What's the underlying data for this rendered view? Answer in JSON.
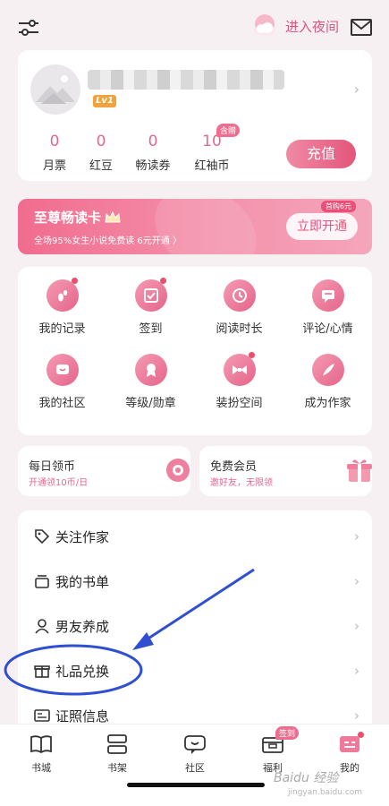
{
  "topbar": {
    "night_mode_label": "进入夜间"
  },
  "profile": {
    "level": "Lv1",
    "stats": [
      {
        "value": "0",
        "label": "月票"
      },
      {
        "value": "0",
        "label": "红豆"
      },
      {
        "value": "0",
        "label": "畅读券"
      },
      {
        "value": "10",
        "label": "红袖币",
        "tag": "含赠"
      }
    ],
    "recharge_label": "充值"
  },
  "vip_banner": {
    "title": "至尊畅读卡",
    "subtitle": "全场95%女生小说免费读 6元开通 〉",
    "button_label": "立即开通",
    "button_tag": "首购6元"
  },
  "grid": [
    {
      "label": "我的记录",
      "icon": "footprint-icon",
      "dot": true
    },
    {
      "label": "签到",
      "icon": "checkin-icon",
      "dot": true
    },
    {
      "label": "阅读时长",
      "icon": "clock-icon",
      "dot": false
    },
    {
      "label": "评论/心情",
      "icon": "comment-icon",
      "dot": false
    },
    {
      "label": "我的社区",
      "icon": "community-icon",
      "dot": false
    },
    {
      "label": "等级/勋章",
      "icon": "medal-icon",
      "dot": false
    },
    {
      "label": "装扮空间",
      "icon": "bowtie-icon",
      "dot": true
    },
    {
      "label": "成为作家",
      "icon": "quill-icon",
      "dot": false
    }
  ],
  "coin_cards": [
    {
      "title": "每日领币",
      "subtitle": "开通领10币/日"
    },
    {
      "title": "免费会员",
      "subtitle": "邀好友，无限领"
    }
  ],
  "menu": [
    {
      "label": "关注作家",
      "icon": "tag-icon"
    },
    {
      "label": "我的书单",
      "icon": "booklist-icon"
    },
    {
      "label": "男友养成",
      "icon": "boyfriend-icon"
    },
    {
      "label": "礼品兑换",
      "icon": "gift-icon"
    },
    {
      "label": "证照信息",
      "icon": "license-icon"
    }
  ],
  "tabs": [
    {
      "label": "书城",
      "icon": "book-icon"
    },
    {
      "label": "书架",
      "icon": "shelf-icon"
    },
    {
      "label": "社区",
      "icon": "chat-icon"
    },
    {
      "label": "福利",
      "icon": "wallet-icon",
      "badge": "签到"
    },
    {
      "label": "我的",
      "icon": "profile-icon",
      "active": true
    }
  ],
  "watermark": {
    "brand": "Baidu 经验",
    "url": "jingyan.baidu.com"
  },
  "colors": {
    "accent": "#e2698f",
    "brand_pink": "#e3557b",
    "annotation": "#2f4fd0"
  }
}
